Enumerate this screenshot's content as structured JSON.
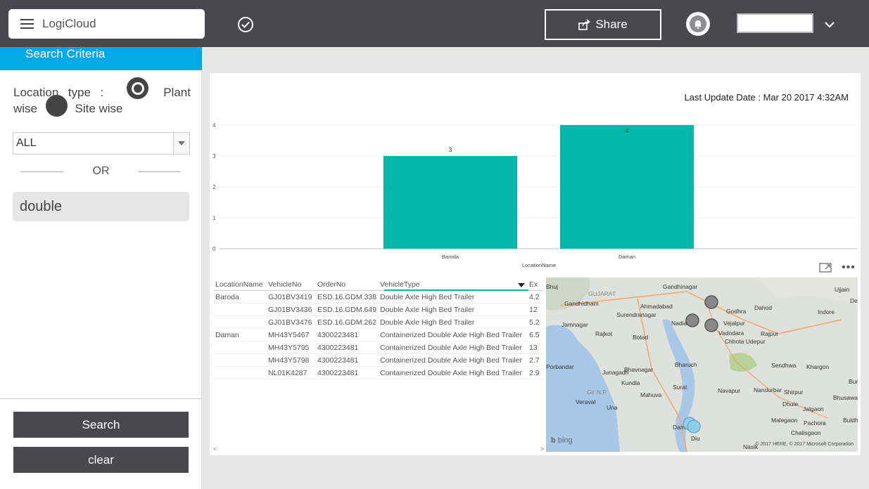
{
  "app": {
    "title": "LogiCloud"
  },
  "topbar": {
    "share_label": "Share"
  },
  "sidebar": {
    "header": "Search Criteria",
    "location_label_1": "Location",
    "location_label_2": "type",
    "location_label_3": ":",
    "option_plant_1": "Plant",
    "option_plant_2": "wise",
    "option_site": "Site wise",
    "select_value": "ALL",
    "or_label": "OR",
    "search_value": "double",
    "search_button": "Search",
    "clear_button": "clear"
  },
  "report": {
    "last_update": "Last Update Date : Mar 20 2017 4:32AM"
  },
  "chart_data": {
    "type": "bar",
    "categories": [
      "Baroda",
      "Daman"
    ],
    "values": [
      3,
      4
    ],
    "xlabel": "LocationName",
    "ylabel": "",
    "ylim": [
      0,
      4
    ],
    "yticks": [
      "0",
      "1",
      "2",
      "3",
      "4"
    ],
    "bar_color": "#01b8aa",
    "grid": true
  },
  "table": {
    "headers": [
      "LocationName",
      "VehicleNo",
      "OrderNo",
      "VehicleType",
      "Ex"
    ],
    "rows": [
      {
        "loc": "Baroda",
        "veh": "GJ01BV3419",
        "order": "ESD.16.GDM.338",
        "type": "Double Axle High Bed Trailer",
        "ex": "4.2"
      },
      {
        "loc": "",
        "veh": "GJ01BV3436",
        "order": "ESD.16.GDM.649",
        "type": "Double Axle High Bed Trailer",
        "ex": "12"
      },
      {
        "loc": "",
        "veh": "GJ01BV3476",
        "order": "ESD.16.GDM.262",
        "type": "Double Axle High Bed Trailer",
        "ex": "5.2"
      },
      {
        "loc": "Daman",
        "veh": "MH43Y5467",
        "order": "4300223481",
        "type": "Containerized Double Axle High Bed Trailer",
        "ex": "6.5"
      },
      {
        "loc": "",
        "veh": "MH43Y5795",
        "order": "4300223481",
        "type": "Containerized Double Axle High Bed Trailer",
        "ex": "13"
      },
      {
        "loc": "",
        "veh": "MH43Y5798",
        "order": "4300223481",
        "type": "Containerized Double Axle High Bed Trailer",
        "ex": "2.7"
      },
      {
        "loc": "",
        "veh": "NL01K4287",
        "order": "4300223481",
        "type": "Containerized Double Axle High Bed Trailer",
        "ex": "2.9"
      }
    ]
  },
  "map": {
    "labels": [
      "Gandhinagar",
      "Ujjain",
      "GUJARAT",
      "Dewas",
      "Gandhidham",
      "Ahmadabad",
      "Godhra",
      "Dahod",
      "Surendranagar",
      "Indore",
      "Nadiad",
      "Vejalpur",
      "Jamnagar",
      "Vadodara",
      "Rajkot",
      "Botad",
      "Rajpur",
      "Chhota Udepur",
      "Bharuch",
      "Sendhwa",
      "Khargon",
      "Bhavnagar",
      "Junagadh",
      "Kundla",
      "Surat",
      "Navapur",
      "Nandurbar",
      "Gir N.P",
      "Mahuva",
      "Shirpur",
      "Bhusawal",
      "Veraval",
      "Una",
      "Dhule",
      "Jalgaon",
      "Malegaon",
      "Pachora",
      "Chalisgaon",
      "Nasik",
      "Porbandar",
      "Bhuj",
      "Daman",
      "Diu",
      "Buldh",
      "Burl"
    ],
    "brand": "bing",
    "copyright": "© 2017 HERE, © 2017 Microsoft Corporation"
  }
}
